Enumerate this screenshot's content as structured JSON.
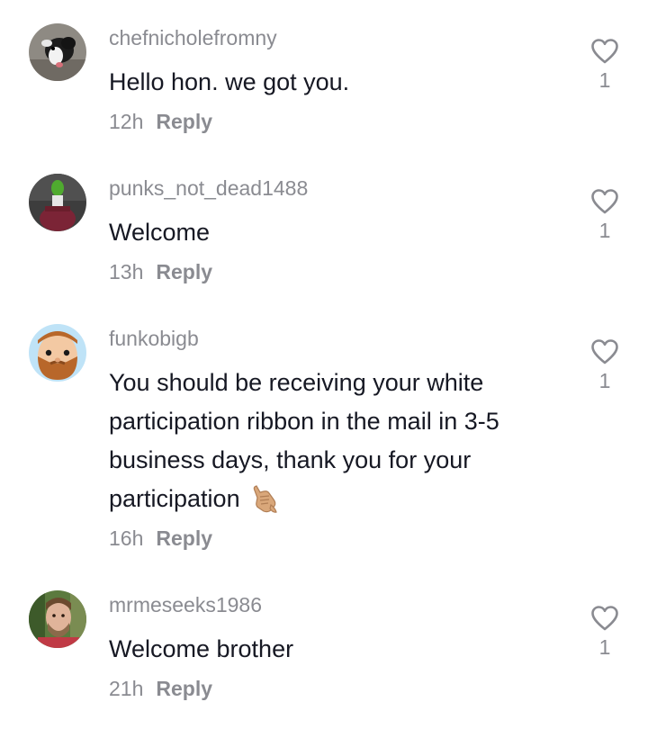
{
  "comments": [
    {
      "username": "chefnicholefromny",
      "text": "Hello hon. we got you.",
      "time": "12h",
      "reply_label": "Reply",
      "likes": "1",
      "avatar_icon": "dog-photo-avatar"
    },
    {
      "username": "punks_not_dead1488",
      "text": "Welcome",
      "time": "13h",
      "reply_label": "Reply",
      "likes": "1",
      "avatar_icon": "green-figure-photo-avatar"
    },
    {
      "username": "funkobigb",
      "text_lines": [
        "You should be receiving your white",
        "participation ribbon in the mail in 3-5",
        "business days, thank you for your",
        "participation"
      ],
      "emoji": "call-me-hand-emoji",
      "time": "16h",
      "reply_label": "Reply",
      "likes": "1",
      "avatar_icon": "bearded-cartoon-avatar"
    },
    {
      "username": "mrmeseeks1986",
      "text": "Welcome brother",
      "time": "21h",
      "reply_label": "Reply",
      "likes": "1",
      "avatar_icon": "man-photo-avatar"
    }
  ],
  "icons": {
    "like": "heart-outline-icon"
  },
  "colors": {
    "text": "#161823",
    "secondary": "#8a8b91",
    "background": "#ffffff"
  }
}
